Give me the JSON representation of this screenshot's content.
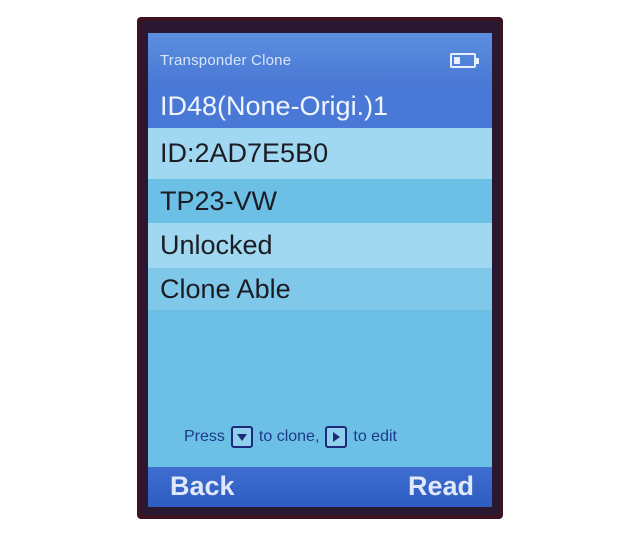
{
  "header": {
    "title": "Transponder Clone",
    "battery_icon": "battery-icon"
  },
  "rows": [
    {
      "label": "ID48(None-Origi.)1",
      "state": "selected"
    },
    {
      "label": "ID:2AD7E5B0"
    },
    {
      "label": "TP23-VW"
    },
    {
      "label": "Unlocked"
    },
    {
      "label": "Clone Able"
    }
  ],
  "hint": {
    "press": "Press",
    "to_clone": "to clone,",
    "to_edit": "to edit",
    "clone_key_icon": "down-arrow-key-icon",
    "edit_key_icon": "right-arrow-key-icon"
  },
  "softkeys": {
    "left": "Back",
    "right": "Read"
  },
  "colors": {
    "screen_bg": "#6cc0e6",
    "selected_bg": "#4a78d6",
    "softbar_bg": "#2f5cc0",
    "device_frame": "#3a1420"
  }
}
